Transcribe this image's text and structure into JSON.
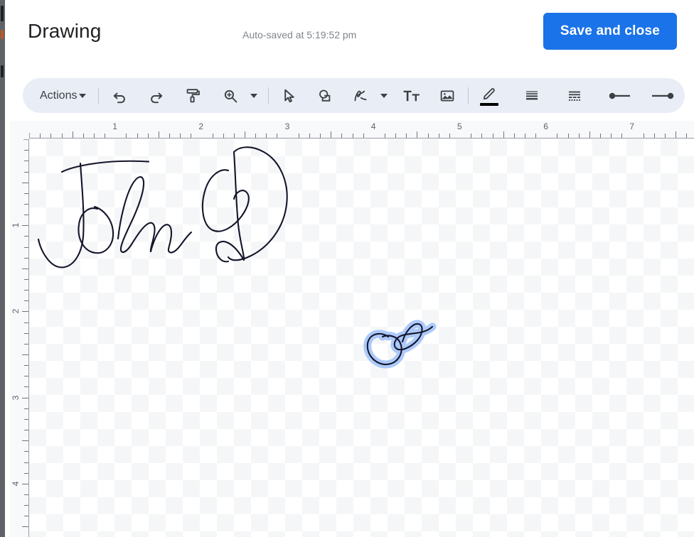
{
  "window": {
    "dialog_title": "Drawing",
    "autosave_status": "Auto-saved at 5:19:52 pm",
    "save_label": "Save and close"
  },
  "toolbar": {
    "actions_label": "Actions",
    "items": [
      {
        "name": "actions-menu",
        "icon": "actions-menu",
        "label": "Actions",
        "has_caret": true
      },
      {
        "name": "undo-button",
        "icon": "undo-icon",
        "label": "Undo"
      },
      {
        "name": "redo-button",
        "icon": "redo-icon",
        "label": "Redo"
      },
      {
        "name": "paint-format-button",
        "icon": "paint-roller-icon",
        "label": "Paint format"
      },
      {
        "name": "zoom-button",
        "icon": "zoom-in-icon",
        "label": "Zoom",
        "has_caret": true
      },
      {
        "name": "select-tool",
        "icon": "cursor-arrow-icon",
        "label": "Select"
      },
      {
        "name": "shape-tool",
        "icon": "shape-icon",
        "label": "Shape"
      },
      {
        "name": "line-tool",
        "icon": "scribble-icon",
        "label": "Line",
        "has_caret": true
      },
      {
        "name": "text-box-tool",
        "icon": "text-box-icon",
        "label": "Text box"
      },
      {
        "name": "image-tool",
        "icon": "image-icon",
        "label": "Image"
      },
      {
        "name": "border-color-tool",
        "icon": "pencil-icon",
        "label": "Border color",
        "color": "#000000"
      },
      {
        "name": "border-weight-tool",
        "icon": "line-weight-icon",
        "label": "Border weight"
      },
      {
        "name": "border-dash-tool",
        "icon": "line-dash-icon",
        "label": "Border dash"
      },
      {
        "name": "line-start-tool",
        "icon": "line-start-icon",
        "label": "Line start"
      },
      {
        "name": "line-end-tool",
        "icon": "line-end-icon",
        "label": "Line end"
      }
    ]
  },
  "rulers": {
    "horizontal_labels": [
      "1",
      "2",
      "3",
      "4",
      "5",
      "6",
      "7"
    ],
    "vertical_labels": [
      "1",
      "2",
      "3",
      "4"
    ],
    "unit": "inch"
  },
  "canvas": {
    "drawing_label": "John Doe",
    "ink_color": "#1a1a2e",
    "selection_glow_color": "#a8c7fa",
    "background": "transparent-checkerboard"
  },
  "colors": {
    "accent": "#1a73e8",
    "toolbar_bg": "#e9edf5",
    "ruler_bg": "#f8f9fb",
    "text_primary": "#202124",
    "text_secondary": "#80868b"
  }
}
